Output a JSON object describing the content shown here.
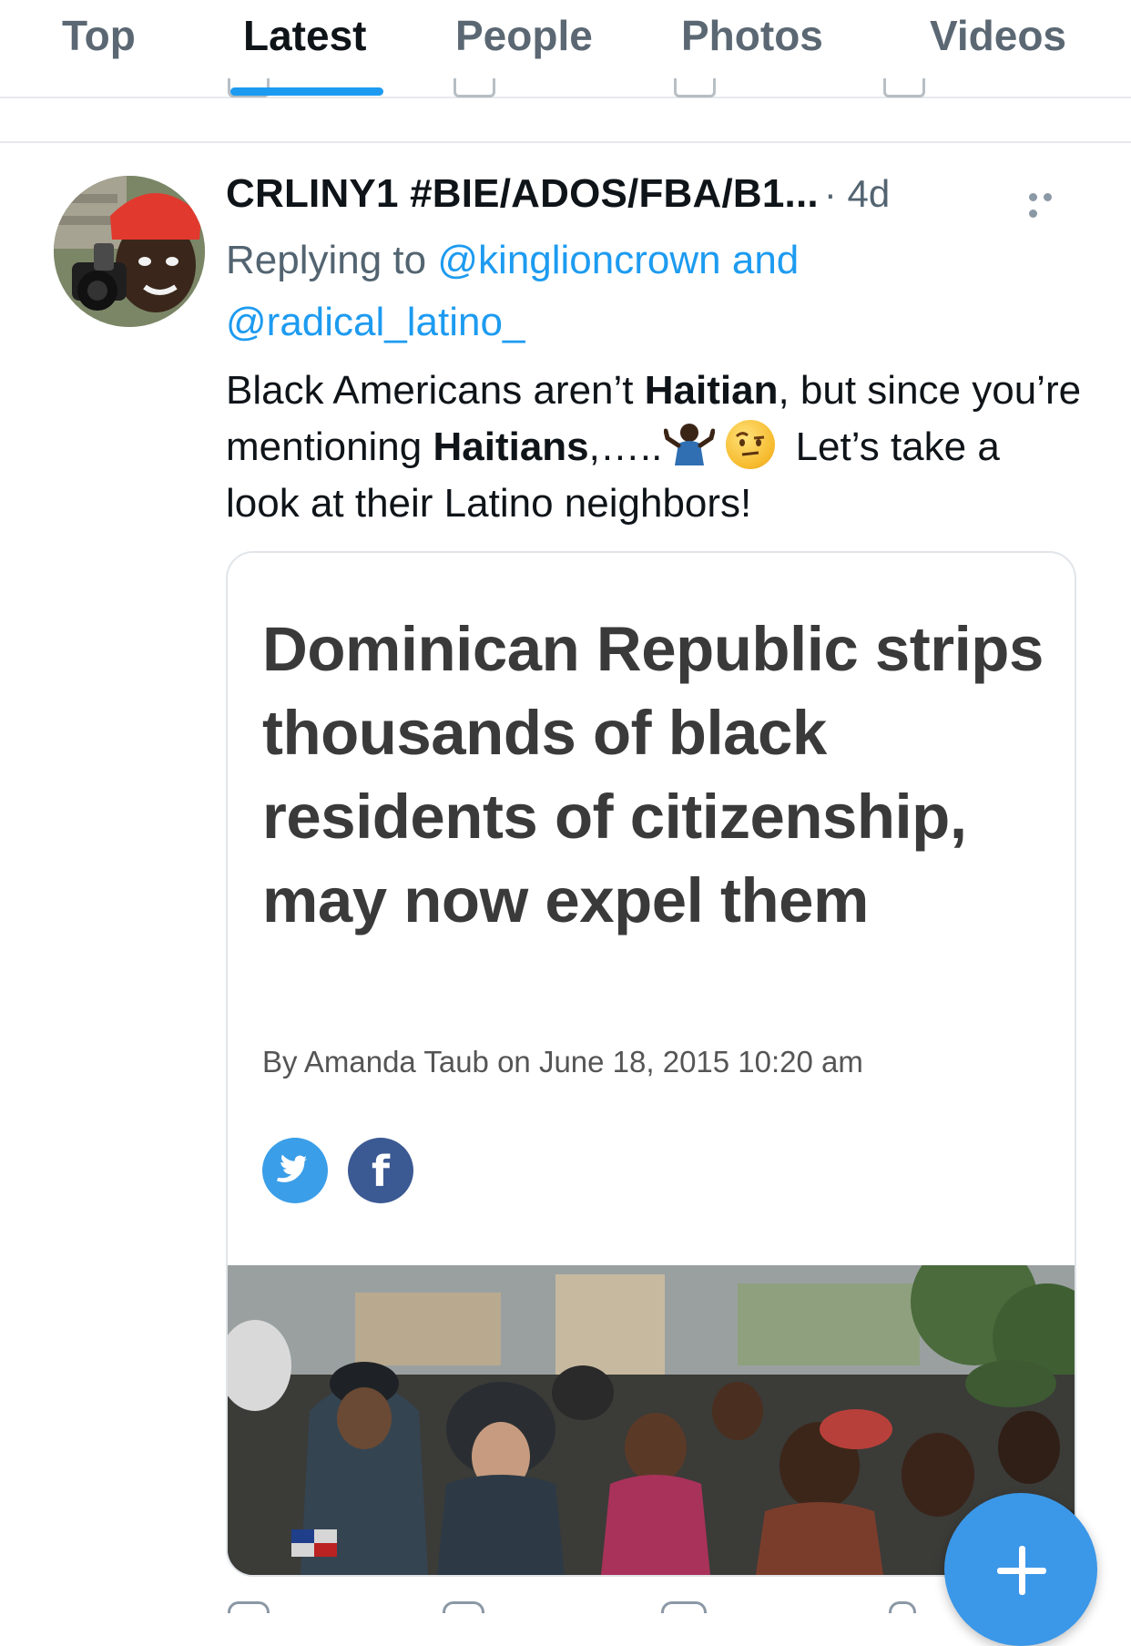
{
  "tabs": [
    {
      "label": "Top",
      "active": false
    },
    {
      "label": "Latest",
      "active": true
    },
    {
      "label": "People",
      "active": false
    },
    {
      "label": "Photos",
      "active": false
    },
    {
      "label": "Videos",
      "active": false
    }
  ],
  "tweet": {
    "display_name": "CRLINY1 #BIE/ADOS/FBA/B1...",
    "separator_time": "· 4d",
    "replying_prefix": "Replying to",
    "mention_1": "@kinglioncrown",
    "and_word": "and",
    "mention_2": "@radical_latino_",
    "text": {
      "p1": "Black Americans aren’t ",
      "b1": "Haitian",
      "p2": ", but since you’re mentioning ",
      "b2": "Haitians",
      "p3": ",…..",
      "p4": " Let’s take a look at their Latino neighbors!"
    },
    "emojis": [
      "person-shrugging-emoji",
      "face-with-raised-eyebrow-emoji"
    ]
  },
  "card": {
    "headline": "Dominican Republic strips thousands of black residents of citizenship, may now expel them",
    "byline": "By Amanda Taub on June 18, 2015 10:20 am",
    "share_fb_glyph": "f"
  },
  "colors": {
    "accent": "#1d9bf0",
    "twitter_share": "#3a9ee8",
    "facebook_share": "#3b5993",
    "fab": "#3b97e8"
  },
  "icons": [
    "more-icon",
    "twitter-share-icon",
    "facebook-share-icon",
    "compose-plus-icon"
  ]
}
